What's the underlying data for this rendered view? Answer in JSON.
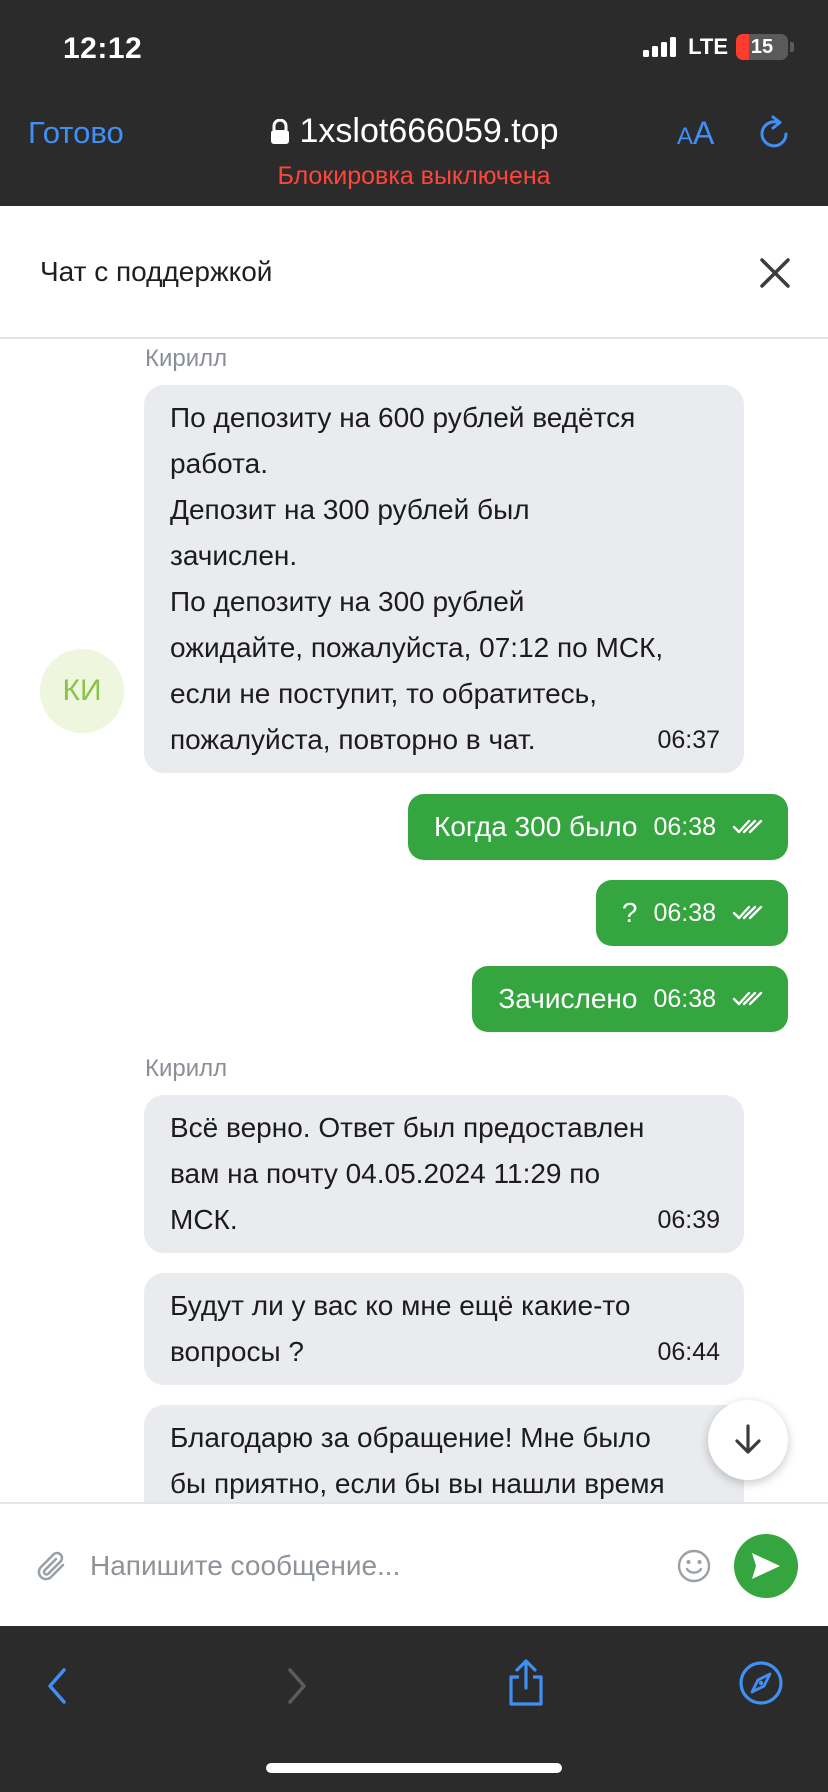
{
  "status_bar": {
    "time": "12:12",
    "network": "LTE",
    "battery": "15"
  },
  "browser": {
    "done_label": "Готово",
    "url": "1xslot666059.top",
    "url_subtitle": "Блокировка выключена",
    "text_size_small": "A",
    "text_size_large": "A"
  },
  "chat": {
    "title": "Чат с поддержкой",
    "agent_name": "Кирилл",
    "agent_initials": "КИ",
    "messages": [
      {
        "lines": [
          "По депозиту на 600 рублей ведётся",
          "работа.",
          "Депозит на 300 рублей был",
          "зачислен.",
          "По депозиту на 300 рублей",
          "ожидайте, пожалуйста, 07:12 по МСК,",
          "если не поступит, то обратитесь,",
          "пожалуйста, повторно в чат."
        ],
        "time": "06:37"
      },
      {
        "text": "Когда 300 было",
        "time": "06:38"
      },
      {
        "text": "?",
        "time": "06:38"
      },
      {
        "text": "Зачислено",
        "time": "06:38"
      },
      {
        "lines": [
          "Всё верно. Ответ был предоставлен",
          "вам на почту 04.05.2024 11:29 по",
          "МСК."
        ],
        "time": "06:39"
      },
      {
        "lines": [
          "Будут ли у вас ко мне ещё какие-то",
          "вопросы ?"
        ],
        "time": "06:44"
      },
      {
        "lines": [
          "Благодарю за обращение! Мне было",
          "бы приятно, если бы вы нашли время"
        ]
      }
    ]
  },
  "composer": {
    "placeholder": "Напишите сообщение..."
  },
  "colors": {
    "accent_green": "#35a540",
    "browser_blue": "#3f8ff5",
    "warning_red": "#ff453a"
  },
  "icons": [
    "lock-icon",
    "reload-icon",
    "close-icon",
    "double-check-icon",
    "arrow-down-icon",
    "paperclip-icon",
    "emoji-icon",
    "send-icon",
    "back-icon",
    "forward-icon",
    "share-icon",
    "compass-icon"
  ]
}
